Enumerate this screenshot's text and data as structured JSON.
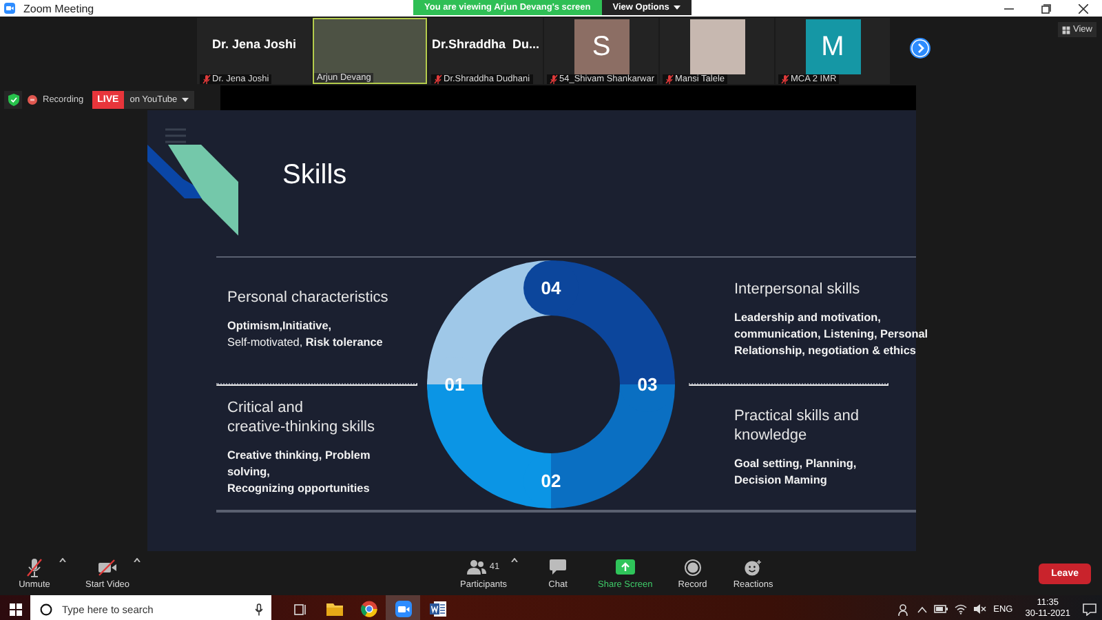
{
  "window": {
    "title": "Zoom Meeting"
  },
  "share_banner": {
    "text": "You are viewing Arjun Devang's screen",
    "options": "View Options"
  },
  "gallery": {
    "participants": [
      {
        "kind": "name",
        "display": "Dr. Jena Joshi",
        "label": "Dr. Jena Joshi",
        "muted": true,
        "speaking": false
      },
      {
        "kind": "video",
        "label": "Arjun Devang",
        "muted": false,
        "speaking": true
      },
      {
        "kind": "name",
        "display": "Dr.Shraddha  Du...",
        "label": "Dr.Shraddha Dudhani",
        "muted": true,
        "speaking": false
      },
      {
        "kind": "avatar",
        "display": "S",
        "color": "#8c6e64",
        "label": "54_Shivam Shankarwar",
        "muted": true,
        "speaking": false
      },
      {
        "kind": "photo",
        "label": "Mansi Talele",
        "muted": true,
        "speaking": false
      },
      {
        "kind": "avatar",
        "display": "M",
        "color": "#1597a5",
        "label": "MCA 2 IMR",
        "muted": true,
        "speaking": false
      }
    ],
    "view_button": "View"
  },
  "recording": {
    "label": "Recording",
    "live_badge": "LIVE",
    "destination": "on YouTube"
  },
  "slide": {
    "title": "Skills",
    "ring": [
      {
        "number": "01",
        "color": "#9fc8e8"
      },
      {
        "number": "02",
        "color": "#0b95e5"
      },
      {
        "number": "03",
        "color": "#0a6fc2"
      },
      {
        "number": "04",
        "color": "#0c469c"
      }
    ],
    "quadrants": [
      {
        "heading": [
          "Personal characteristics"
        ],
        "body_bold": false,
        "body": [
          "**Optimism,Initiative,**",
          "Self-motivated, **Risk tolerance**"
        ]
      },
      {
        "heading": [
          "Critical and",
          "creative-thinking skills"
        ],
        "body_bold": true,
        "body": [
          "Creative thinking, Problem",
          "solving,",
          "Recognizing opportunities"
        ]
      },
      {
        "heading": [
          "Interpersonal skills"
        ],
        "body_bold": true,
        "body": [
          "Leadership and motivation,",
          "communication, Listening, Personal",
          "Relationship, negotiation & ethics"
        ]
      },
      {
        "heading": [
          "Practical skills and",
          "knowledge"
        ],
        "body_bold": true,
        "body": [
          "Goal setting, Planning,",
          "Decision Maming"
        ]
      }
    ]
  },
  "toolbar": {
    "left": [
      {
        "kind": "mic",
        "label": "Unmute",
        "muted": true
      },
      {
        "kind": "video",
        "label": "Start Video",
        "muted": true
      }
    ],
    "center": [
      {
        "kind": "participants",
        "label": "Participants",
        "count": "41"
      },
      {
        "kind": "chat",
        "label": "Chat"
      },
      {
        "kind": "share",
        "label": "Share Screen"
      },
      {
        "kind": "record",
        "label": "Record"
      },
      {
        "kind": "reactions",
        "label": "Reactions"
      }
    ],
    "leave": "Leave"
  },
  "taskbar": {
    "search_placeholder": "Type here to search",
    "apps": [
      {
        "kind": "explorer",
        "selected": false
      },
      {
        "kind": "browser",
        "selected": false
      },
      {
        "kind": "zoom",
        "selected": true
      },
      {
        "kind": "word",
        "selected": false
      }
    ],
    "language": "ENG",
    "time": "11:35",
    "date": "30-11-2021"
  }
}
